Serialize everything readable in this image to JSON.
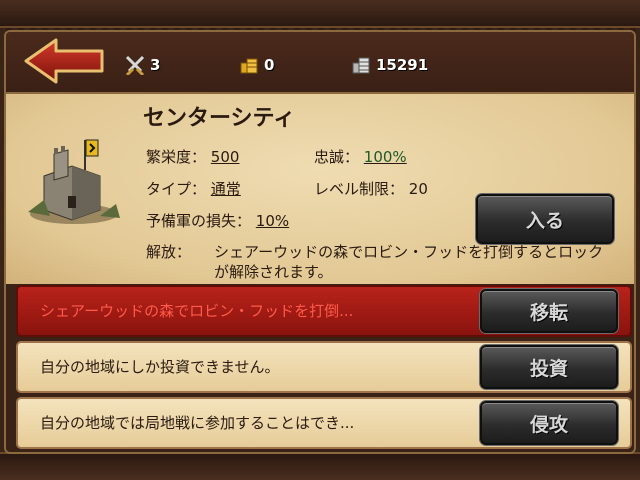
{
  "header": {
    "back_icon": "back-arrow-icon",
    "resources": [
      {
        "icon": "crossed-swords-icon",
        "value": "3"
      },
      {
        "icon": "gold-coins-icon",
        "value": "0"
      },
      {
        "icon": "silver-coins-icon",
        "value": "15291"
      }
    ]
  },
  "city": {
    "name": "センターシティ",
    "prosperity_label": "繁栄度：",
    "prosperity_value": "500",
    "loyalty_label": "忠誠：",
    "loyalty_value": "100%",
    "type_label": "タイプ：",
    "type_value": "通常",
    "level_limit_label": "レベル制限：",
    "level_limit_value": "20",
    "reserve_loss_label": "予備軍の損失：",
    "reserve_loss_value": "10%",
    "unlock_label": "解放：",
    "unlock_text": "シェアーウッドの森でロビン・フッドを打倒するとロックが解除されます。",
    "enter_button": "入る"
  },
  "actions": [
    {
      "text": "シェアーウッドの森でロビン・フッドを打倒...",
      "button": "移転",
      "highlight": true
    },
    {
      "text": "自分の地域にしか投資できません。",
      "button": "投資",
      "highlight": false
    },
    {
      "text": "自分の地域では局地戦に参加することはでき...",
      "button": "侵攻",
      "highlight": false
    }
  ],
  "colors": {
    "accent_red": "#b8231a",
    "parchment": "#e6cc98",
    "button_dark": "#2c2c2c"
  }
}
